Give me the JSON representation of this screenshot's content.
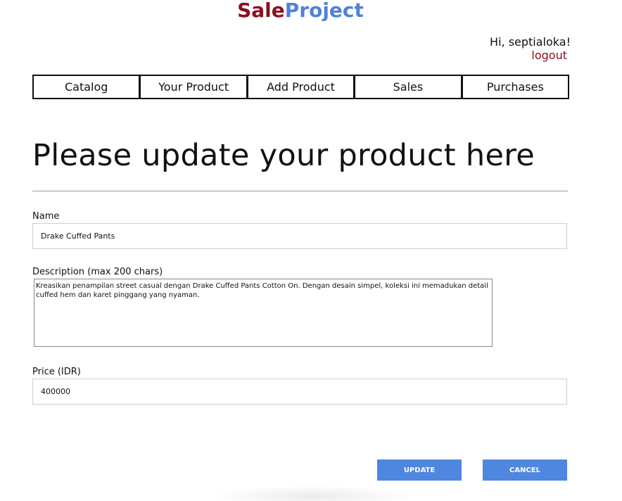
{
  "app": {
    "logo_part1": "Sale",
    "logo_part2": "Project",
    "colors": {
      "logo_sale": "#8b1020",
      "logo_project": "#4f82d8",
      "button": "#4f86e0"
    }
  },
  "user": {
    "greeting": "Hi, septialoka!",
    "logout_label": "logout"
  },
  "nav": {
    "items": [
      "Catalog",
      "Your Product",
      "Add Product",
      "Sales",
      "Purchases"
    ]
  },
  "form": {
    "title": "Please update your product here",
    "name_label": "Name",
    "name_value": "Drake Cuffed Pants",
    "description_label": "Description (max 200 chars)",
    "description_value": "Kreasikan penampilan street casual dengan Drake Cuffed Pants Cotton On. Dengan desain simpel, koleksi ini memadukan detail cuffed hem dan karet pinggang yang nyaman.",
    "price_label": "Price (IDR)",
    "price_value": "400000",
    "update_label": "UPDATE",
    "cancel_label": "CANCEL"
  }
}
